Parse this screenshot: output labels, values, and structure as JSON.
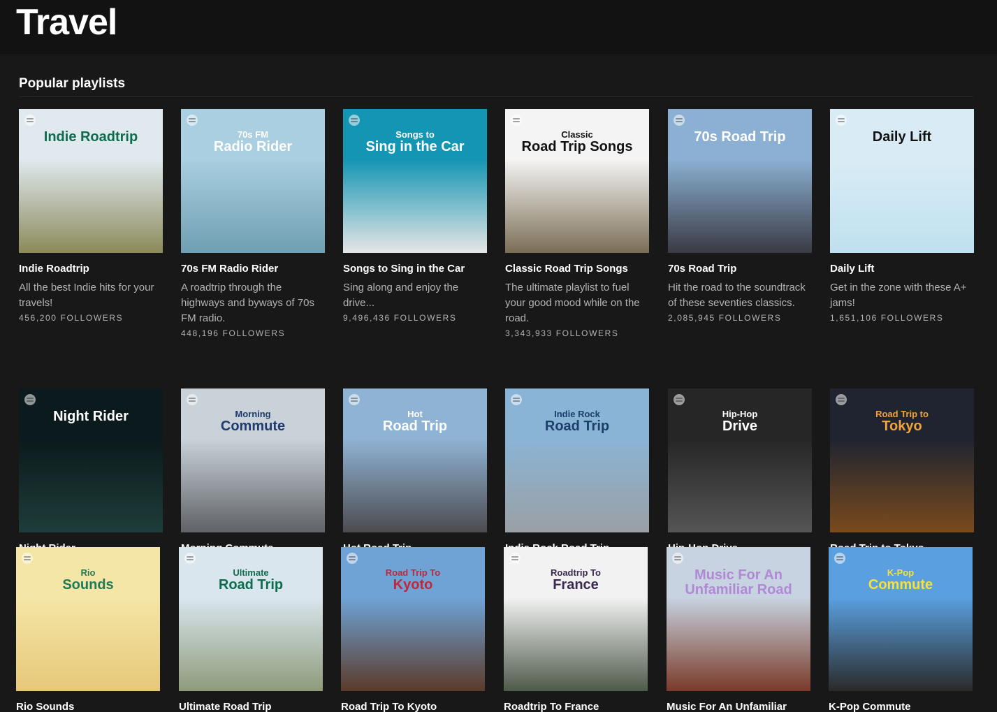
{
  "page": {
    "title": "Travel"
  },
  "section": {
    "title": "Popular playlists"
  },
  "playlists": [
    {
      "title": "Indie Roadtrip",
      "description": "All the best Indie hits for your travels!",
      "followers": "456,200 FOLLOWERS",
      "cover_kicker": "",
      "cover_text": "Indie Roadtrip",
      "cover_text_color": "#0f6b4e",
      "bg_top": "#dfe9ee",
      "bg_bottom": "#8c8a5a"
    },
    {
      "title": "70s FM Radio Rider",
      "description": "A roadtrip through the highways and byways of 70s FM radio.",
      "followers": "448,196 FOLLOWERS",
      "cover_kicker": "70s FM",
      "cover_text": "Radio Rider",
      "cover_text_color": "#ffffff",
      "bg_top": "#a9cfe0",
      "bg_bottom": "#6f9fb2"
    },
    {
      "title": "Songs to Sing in the Car",
      "description": "Sing along and enjoy the drive...",
      "followers": "9,496,436 FOLLOWERS",
      "cover_kicker": "Songs to",
      "cover_text": "Sing in the Car",
      "cover_text_color": "#ffffff",
      "bg_top": "#1495b3",
      "bg_bottom": "#e6e6e6"
    },
    {
      "title": "Classic Road Trip Songs",
      "description": "The ultimate playlist to fuel your good mood while on the road.",
      "followers": "3,343,933 FOLLOWERS",
      "cover_kicker": "Classic",
      "cover_text": "Road Trip Songs",
      "cover_text_color": "#111111",
      "bg_top": "#f4f4f4",
      "bg_bottom": "#7b6e55"
    },
    {
      "title": "70s Road Trip",
      "description": "Hit the road to the soundtrack of these seventies classics.",
      "followers": "2,085,945 FOLLOWERS",
      "cover_kicker": "",
      "cover_text": "70s Road Trip",
      "cover_text_color": "#ffffff",
      "bg_top": "#8bb0d3",
      "bg_bottom": "#3a3a44"
    },
    {
      "title": "Daily Lift",
      "description": "Get in the zone with these A+ jams!",
      "followers": "1,651,106 FOLLOWERS",
      "cover_kicker": "",
      "cover_text": "Daily Lift",
      "cover_text_color": "#111111",
      "bg_top": "#d9ecf5",
      "bg_bottom": "#bfe0ef"
    },
    {
      "title": "Night Rider",
      "description": "",
      "followers": "",
      "cover_kicker": "",
      "cover_text": "Night Rider",
      "cover_text_color": "#ffffff",
      "bg_top": "#0b1a1c",
      "bg_bottom": "#1e3d3a"
    },
    {
      "title": "Morning Commute",
      "description": "",
      "followers": "",
      "cover_kicker": "Morning",
      "cover_text": "Commute",
      "cover_text_color": "#1f3a6e",
      "bg_top": "#c9d2d9",
      "bg_bottom": "#5f6266"
    },
    {
      "title": "Hot Road Trip",
      "description": "",
      "followers": "",
      "cover_kicker": "Hot",
      "cover_text": "Road Trip",
      "cover_text_color": "#ffffff",
      "bg_top": "#8fb3d4",
      "bg_bottom": "#4d4b50"
    },
    {
      "title": "Indie Rock Road Trip",
      "description": "",
      "followers": "",
      "cover_kicker": "Indie Rock",
      "cover_text": "Road Trip",
      "cover_text_color": "#1c3f6b",
      "bg_top": "#8ab4d6",
      "bg_bottom": "#9aa0a4"
    },
    {
      "title": "Hip-Hop Drive",
      "description": "",
      "followers": "",
      "cover_kicker": "Hip-Hop",
      "cover_text": "Drive",
      "cover_text_color": "#ffffff",
      "bg_top": "#262626",
      "bg_bottom": "#555555"
    },
    {
      "title": "Road Trip to Tokyo",
      "description": "",
      "followers": "",
      "cover_kicker": "Road Trip to",
      "cover_text": "Tokyo",
      "cover_text_color": "#f2a33a",
      "bg_top": "#1f2430",
      "bg_bottom": "#7a4a1c"
    },
    {
      "title": "Rio Sounds",
      "description": "",
      "followers": "",
      "cover_kicker": "Rio",
      "cover_text": "Sounds",
      "cover_text_color": "#1f7a57",
      "bg_top": "#f4e6a6",
      "bg_bottom": "#e7c77a"
    },
    {
      "title": "Ultimate Road Trip",
      "description": "",
      "followers": "",
      "cover_kicker": "Ultimate",
      "cover_text": "Road Trip",
      "cover_text_color": "#0f6b4e",
      "bg_top": "#d9e6ee",
      "bg_bottom": "#8e9b7a"
    },
    {
      "title": "Road Trip To Kyoto",
      "description": "",
      "followers": "",
      "cover_kicker": "Road Trip To",
      "cover_text": "Kyoto",
      "cover_text_color": "#c0273a",
      "bg_top": "#6fa3d6",
      "bg_bottom": "#5b3a2a"
    },
    {
      "title": "Roadtrip To France",
      "description": "",
      "followers": "",
      "cover_kicker": "Roadtrip To",
      "cover_text": "France",
      "cover_text_color": "#3a2a4e",
      "bg_top": "#f2f2f2",
      "bg_bottom": "#4e5a4a"
    },
    {
      "title": "Music For An Unfamiliar",
      "description": "",
      "followers": "",
      "cover_kicker": "",
      "cover_text": "Music For An Unfamiliar Road",
      "cover_text_color": "#b088d4",
      "bg_top": "#c7d3e0",
      "bg_bottom": "#7a3a2a"
    },
    {
      "title": "K-Pop Commute",
      "description": "",
      "followers": "",
      "cover_kicker": "K-Pop",
      "cover_text": "Commute",
      "cover_text_color": "#f6e23a",
      "bg_top": "#5aa0e0",
      "bg_bottom": "#2a2a2a"
    }
  ]
}
